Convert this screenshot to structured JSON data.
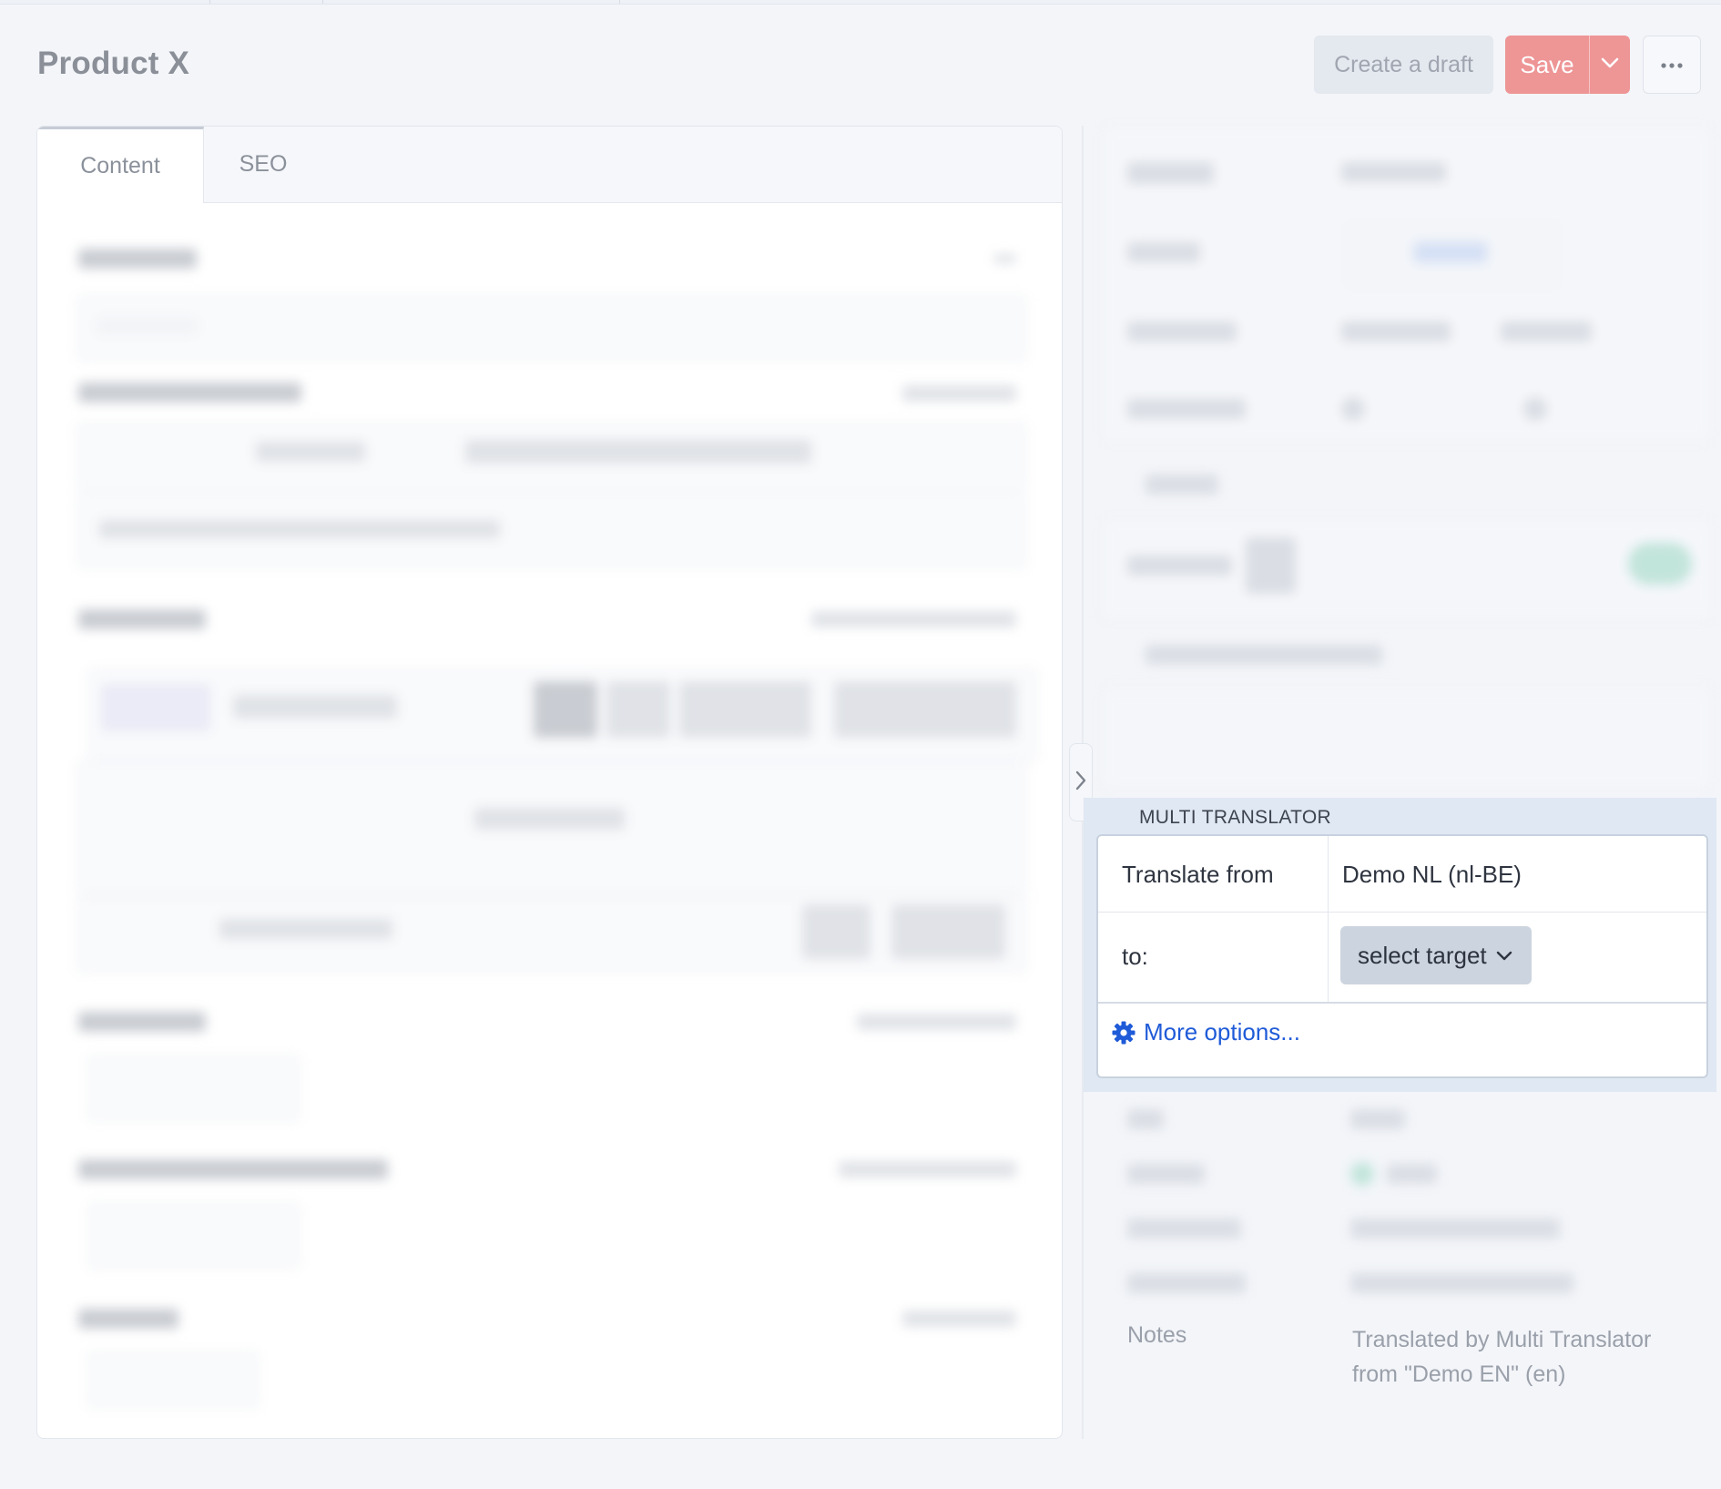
{
  "header": {
    "title": "Product X",
    "create_draft_label": "Create a draft",
    "save_label": "Save"
  },
  "tabs": [
    {
      "label": "Content",
      "active": true
    },
    {
      "label": "SEO",
      "active": false
    }
  ],
  "multi_translator": {
    "heading": "MULTI TRANSLATOR",
    "translate_from_label": "Translate from",
    "translate_from_value": "Demo NL (nl-BE)",
    "to_label": "to:",
    "select_target_label": "select target",
    "more_options_label": "More options..."
  },
  "notes": {
    "label": "Notes",
    "value": "Translated by Multi Translator from \"Demo EN\" (en)"
  },
  "colors": {
    "save_button": "#ee9596",
    "link": "#1f5bd8",
    "translator_panel": "#dfe8f3"
  }
}
